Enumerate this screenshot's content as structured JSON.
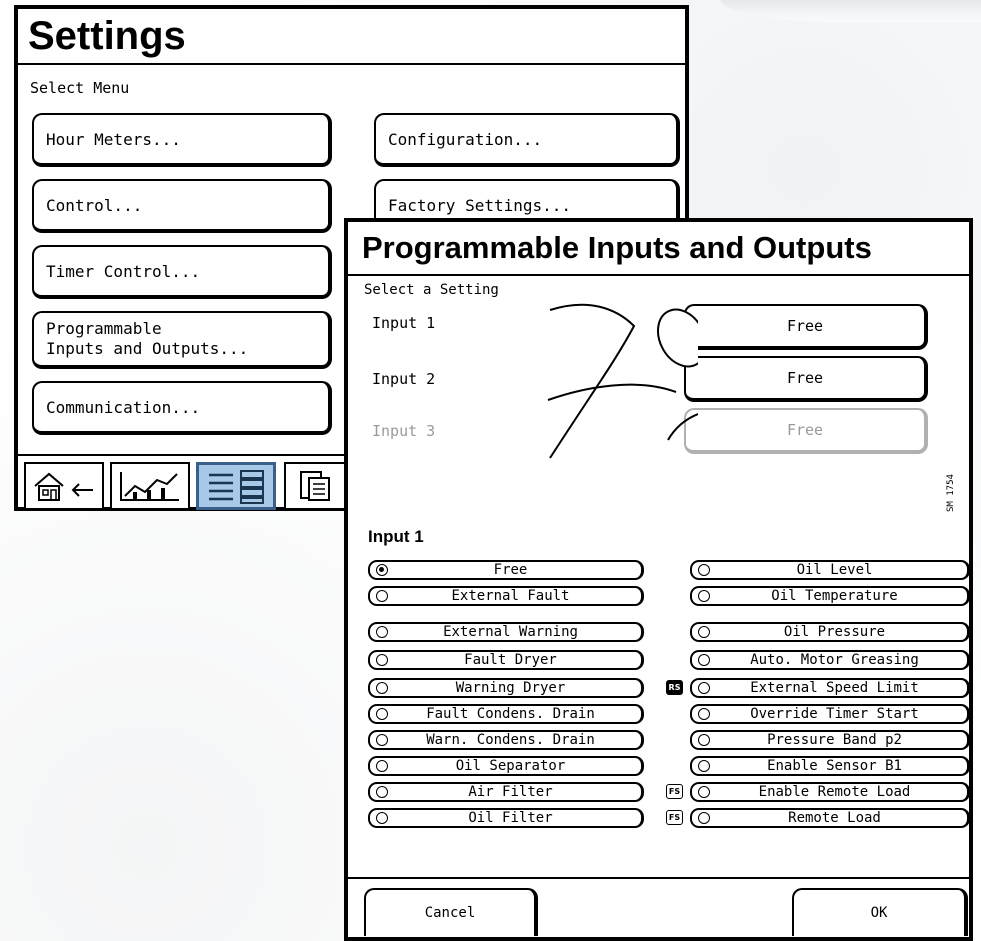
{
  "settings": {
    "title": "Settings",
    "subtitle": "Select Menu",
    "menu_left": [
      "Hour Meters...",
      "Control...",
      "Timer Control...",
      "Programmable\nInputs and Outputs...",
      "Communication..."
    ],
    "menu_right": [
      "Configuration...",
      "Factory Settings..."
    ],
    "toolbar_icons": [
      "home-back-icon",
      "chart-icon",
      "menu-list-icon",
      "document-icon"
    ]
  },
  "pio": {
    "title": "Programmable Inputs and Outputs",
    "subtitle": "Select a Setting",
    "inputs": [
      {
        "label": "Input 1",
        "value": "Free"
      },
      {
        "label": "Input 2",
        "value": "Free"
      },
      {
        "label": "Input 3",
        "value": "Free"
      }
    ],
    "section_label": "Input 1",
    "sm_code": "SM 1754",
    "options_left": [
      "Free",
      "External Fault",
      "External Warning",
      "Fault Dryer",
      "Warning Dryer",
      "Fault Condens. Drain",
      "Warn. Condens. Drain",
      "Oil Separator",
      "Air Filter",
      "Oil Filter"
    ],
    "options_right": [
      "Oil Level",
      "Oil Temperature",
      "Oil Pressure",
      "Auto. Motor Greasing",
      "External Speed Limit",
      "Override Timer Start",
      "Pressure Band p2",
      "Enable Sensor B1",
      "Enable Remote Load",
      "Remote Load"
    ],
    "selected_option": "Free",
    "tags": {
      "rs": "RS",
      "fs1": "FS",
      "fs2": "FS"
    },
    "cancel_label": "Cancel",
    "ok_label": "OK"
  },
  "colors": {
    "active_tool": "#a8c8e8",
    "dim_text": "#9a9a9a"
  }
}
